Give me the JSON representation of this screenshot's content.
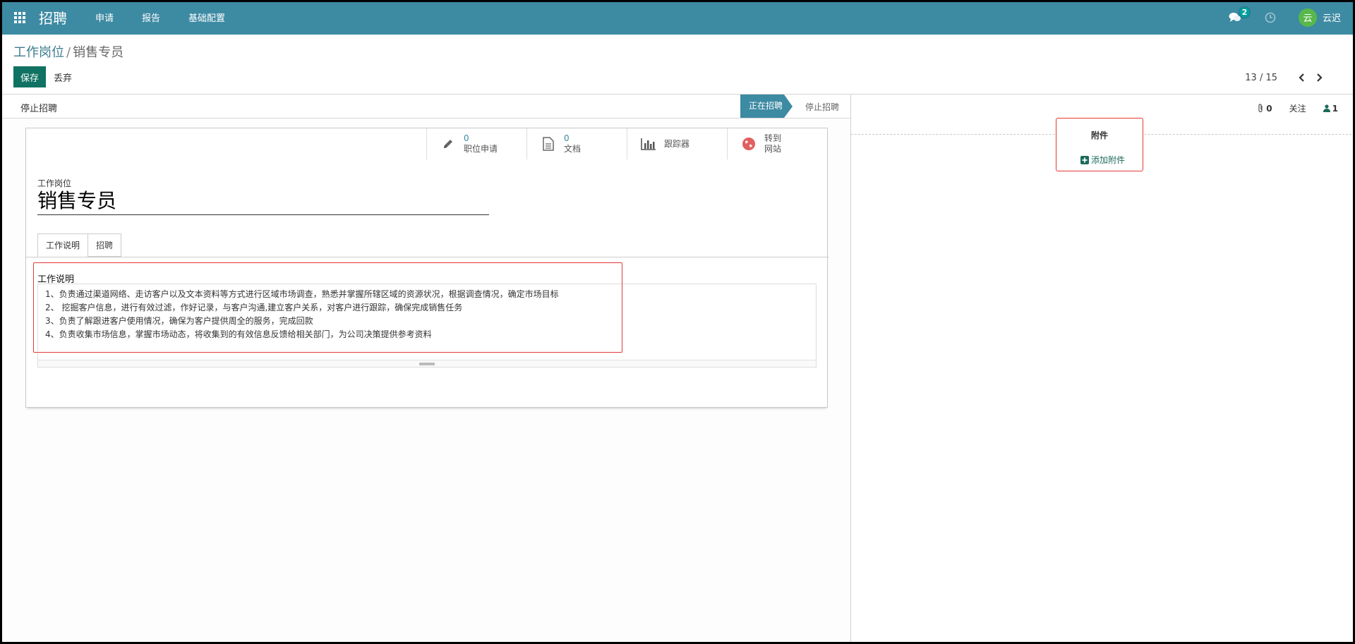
{
  "navbar": {
    "brand": "招聘",
    "menu": [
      "申请",
      "报告",
      "基础配置"
    ],
    "chat_count": "2",
    "user_initial": "云",
    "user_name": "云迟",
    "color": "#3d8aa3"
  },
  "breadcrumb": {
    "parent": "工作岗位",
    "separator": "/",
    "current": "销售专员"
  },
  "actions": {
    "save": "保存",
    "discard": "丢弃"
  },
  "pager": {
    "text": "13 / 15"
  },
  "statusbar": {
    "stop_button": "停止招聘",
    "stage_active": "正在招聘",
    "stage_next": "停止招聘"
  },
  "smart_buttons": [
    {
      "num": "0",
      "label": "职位申请",
      "icon": "pencil-icon"
    },
    {
      "num": "0",
      "label": "文档",
      "icon": "document-icon"
    },
    {
      "num": "",
      "label": "跟踪器",
      "icon": "bar-chart-icon"
    },
    {
      "num": "转到",
      "label": "网站",
      "icon": "globe-icon"
    }
  ],
  "form": {
    "name_label": "工作岗位",
    "name_value": "销售专员",
    "tabs": [
      "工作说明",
      "招聘"
    ],
    "description_label": "工作说明",
    "description_lines": [
      "1、负责通过渠道网络、走访客户以及文本资料等方式进行区域市场调查，熟悉并掌握所辖区域的资源状况，根据调查情况，确定市场目标",
      "2、 挖掘客户信息，进行有效过滤，作好记录，与客户沟通,建立客户关系，对客户进行跟踪，确保完成销售任务",
      "3、负责了解跟进客户使用情况，确保为客户提供周全的服务，完成回款",
      "4、负责收集市场信息，掌握市场动态，将收集到的有效信息反馈给相关部门，为公司决策提供参考资料"
    ]
  },
  "chatter": {
    "attachment_count": "0",
    "follow": "关注",
    "follower_count": "1",
    "attach_title": "附件",
    "add_attachment": "添加附件"
  }
}
